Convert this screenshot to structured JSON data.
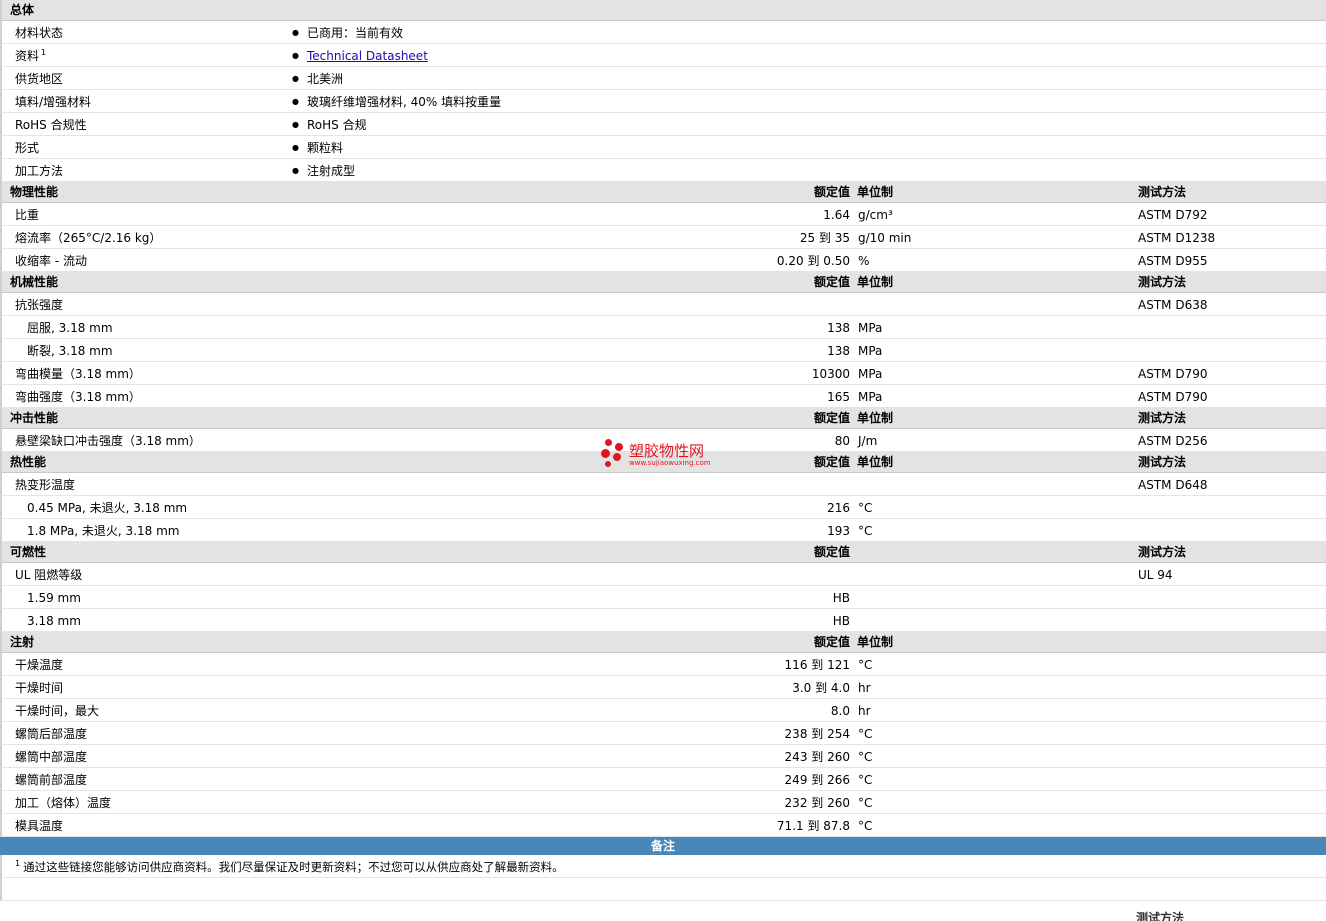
{
  "general": {
    "title": "总体",
    "rows": [
      {
        "label": "材料状态",
        "value": "已商用：当前有效"
      },
      {
        "label": "资料",
        "sup": "1",
        "link": "Technical Datasheet"
      },
      {
        "label": "供货地区",
        "value": "北美洲"
      },
      {
        "label": "填料/增强材料",
        "value": "玻璃纤维增强材料, 40% 填料按重量"
      },
      {
        "label": "RoHS 合规性",
        "value": "RoHS 合规"
      },
      {
        "label": "形式",
        "value": "颗粒料"
      },
      {
        "label": "加工方法",
        "value": "注射成型"
      }
    ]
  },
  "headers": {
    "nominal": "额定值",
    "unit": "单位制",
    "test": "测试方法"
  },
  "sections": [
    {
      "title": "物理性能",
      "show_unit": true,
      "show_test": true,
      "rows": [
        {
          "label": "比重",
          "value": "1.64",
          "unit": "g/cm³",
          "test": "ASTM D792"
        },
        {
          "label": "熔流率（265°C/2.16 kg）",
          "value": "25 到  35",
          "unit": "g/10 min",
          "test": "ASTM D1238"
        },
        {
          "label": "收缩率 - 流动",
          "value": "0.20 到  0.50",
          "unit": "%",
          "test": "ASTM D955"
        }
      ]
    },
    {
      "title": "机械性能",
      "show_unit": true,
      "show_test": true,
      "rows": [
        {
          "label": "抗张强度",
          "value": "",
          "unit": "",
          "test": "ASTM D638"
        },
        {
          "label": "屈服, 3.18 mm",
          "sub": true,
          "value": "138",
          "unit": "MPa",
          "test": ""
        },
        {
          "label": "断裂, 3.18 mm",
          "sub": true,
          "value": "138",
          "unit": "MPa",
          "test": ""
        },
        {
          "label": "弯曲模量（3.18 mm）",
          "value": "10300",
          "unit": "MPa",
          "test": "ASTM D790"
        },
        {
          "label": "弯曲强度（3.18 mm）",
          "value": "165",
          "unit": "MPa",
          "test": "ASTM D790"
        }
      ]
    },
    {
      "title": "冲击性能",
      "show_unit": true,
      "show_test": true,
      "rows": [
        {
          "label": "悬壁梁缺口冲击强度（3.18 mm）",
          "value": "80",
          "unit": "J/m",
          "test": "ASTM D256"
        }
      ]
    },
    {
      "title": "热性能",
      "show_unit": true,
      "show_test": true,
      "rows": [
        {
          "label": "热变形温度",
          "value": "",
          "unit": "",
          "test": "ASTM D648"
        },
        {
          "label": "0.45 MPa, 未退火, 3.18 mm",
          "sub": true,
          "value": "216",
          "unit": "°C",
          "test": ""
        },
        {
          "label": "1.8 MPa, 未退火, 3.18 mm",
          "sub": true,
          "value": "193",
          "unit": "°C",
          "test": ""
        }
      ]
    },
    {
      "title": "可燃性",
      "show_unit": false,
      "show_test": true,
      "rows": [
        {
          "label": "UL 阻燃等级",
          "value": "",
          "unit": "",
          "test": "UL 94"
        },
        {
          "label": "1.59 mm",
          "sub": true,
          "value": "HB",
          "unit": "",
          "test": ""
        },
        {
          "label": "3.18 mm",
          "sub": true,
          "value": "HB",
          "unit": "",
          "test": ""
        }
      ]
    },
    {
      "title": "注射",
      "show_unit": true,
      "show_test": false,
      "rows": [
        {
          "label": "干燥温度",
          "value": "116 到  121",
          "unit": "°C",
          "test": ""
        },
        {
          "label": "干燥时间",
          "value": "3.0 到  4.0",
          "unit": "hr",
          "test": ""
        },
        {
          "label": "干燥时间，最大",
          "value": "8.0",
          "unit": "hr",
          "test": ""
        },
        {
          "label": "螺筒后部温度",
          "value": "238 到  254",
          "unit": "°C",
          "test": ""
        },
        {
          "label": "螺筒中部温度",
          "value": "243 到  260",
          "unit": "°C",
          "test": ""
        },
        {
          "label": "螺筒前部温度",
          "value": "249 到  266",
          "unit": "°C",
          "test": ""
        },
        {
          "label": "加工（熔体）温度",
          "value": "232 到  260",
          "unit": "°C",
          "test": ""
        },
        {
          "label": "模具温度",
          "value": "71.1 到  87.8",
          "unit": "°C",
          "test": ""
        }
      ]
    }
  ],
  "notes": {
    "title": "备注",
    "sup": "1",
    "text": "通过这些链接您能够访问供应商资料。我们尽量保证及时更新资料；不过您可以从供应商处了解最新资料。"
  },
  "cut_row": {
    "test": "测试方法"
  },
  "watermark": {
    "name": "塑胶物性网",
    "url": "www.sujiaowuxing.com"
  },
  "colors": {
    "notes_bar": "#4a87b9",
    "section_bg": "#e3e3e3",
    "watermark": "#e0161f",
    "link": "#1a0dab"
  }
}
